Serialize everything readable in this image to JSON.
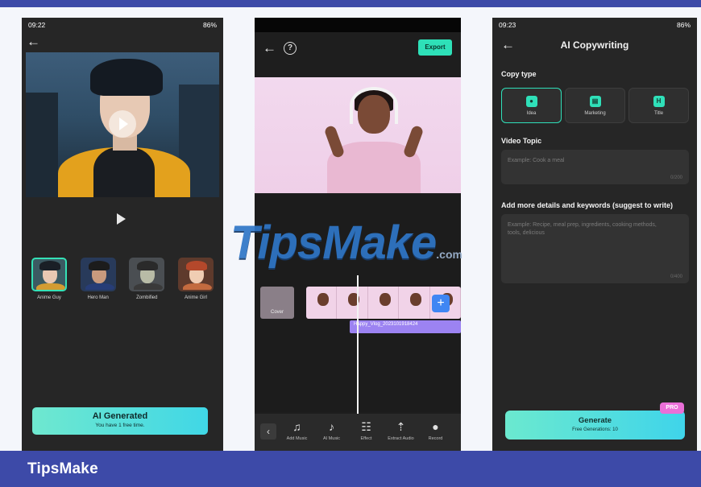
{
  "brand": {
    "footer": "TipsMake",
    "watermark": "TipsMake",
    "watermark_suffix": ".com"
  },
  "phone1": {
    "status": {
      "time": "09:22",
      "right": "86%"
    },
    "styles": [
      {
        "label": "Anime Guy",
        "selected": true
      },
      {
        "label": "Hero Man",
        "selected": false
      },
      {
        "label": "Zombified",
        "selected": false
      },
      {
        "label": "Anime Girl",
        "selected": false
      }
    ],
    "button": {
      "title": "AI Generated",
      "subtitle": "You have 1 free time."
    }
  },
  "phone2": {
    "export_label": "Export",
    "help_label": "?",
    "cover_label": "Cover",
    "audio_label": "Happy_Vlog_2023101918424",
    "tools": [
      {
        "icon": "add-music-icon",
        "label": "Add Music"
      },
      {
        "icon": "ai-music-icon",
        "label": "AI Music"
      },
      {
        "icon": "effect-icon",
        "label": "Effect"
      },
      {
        "icon": "extract-audio-icon",
        "label": "Extract Audio"
      },
      {
        "icon": "record-icon",
        "label": "Record"
      }
    ]
  },
  "phone3": {
    "status": {
      "time": "09:23",
      "right": "86%"
    },
    "title": "AI Copywriting",
    "copy_type_label": "Copy type",
    "copy_types": [
      {
        "label": "Idea",
        "icon": "bulb-icon",
        "selected": true
      },
      {
        "label": "Marketing",
        "icon": "marketing-icon",
        "selected": false
      },
      {
        "label": "Title",
        "icon": "title-icon",
        "selected": false
      }
    ],
    "video_topic_label": "Video Topic",
    "video_topic_placeholder": "Example: Cook a meal",
    "video_topic_count": "0/200",
    "details_label": "Add more details and keywords (suggest to write)",
    "details_placeholder": "Example: Recipe, meal prep, ingredients, cooking methods, tools, delicious",
    "details_count": "0/400",
    "generate": {
      "title": "Generate",
      "subtitle": "Free Generations: 10",
      "badge": "PRO"
    }
  },
  "colors": {
    "accent": "#2ee0b8",
    "band": "#3d4aa8",
    "pro": "#ea6fd8"
  }
}
